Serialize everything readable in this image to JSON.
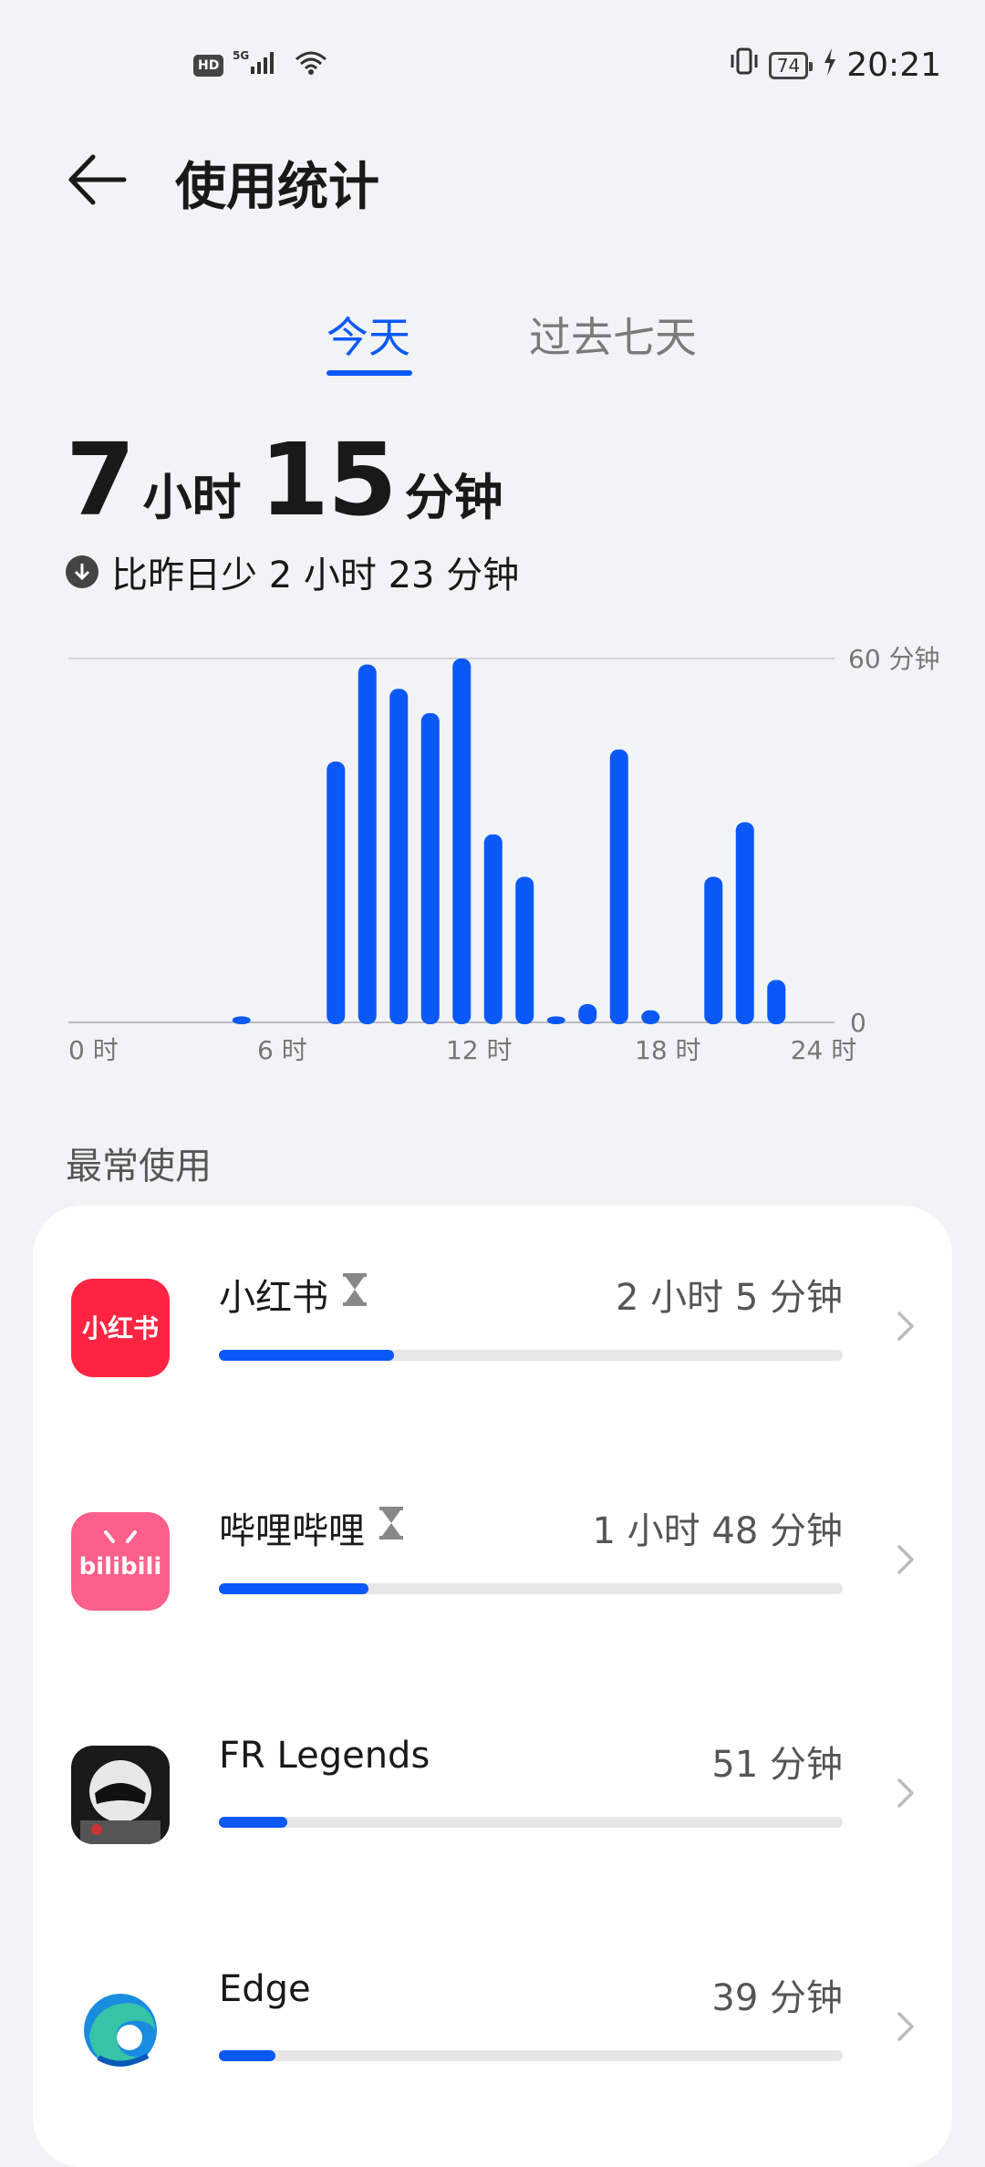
{
  "status_bar": {
    "left_badge": "HD",
    "network": "5G",
    "battery": "74",
    "time": "20:21"
  },
  "header": {
    "title": "使用统计",
    "back_icon": "back-arrow-icon"
  },
  "tabs": [
    {
      "label": "今天",
      "active": true
    },
    {
      "label": "过去七天",
      "active": false
    }
  ],
  "summary": {
    "hours": "7",
    "hours_unit": "小时",
    "minutes": "15",
    "minutes_unit": "分钟",
    "compare_text": "比昨日少 2 小时 23 分钟"
  },
  "chart_data": {
    "type": "bar",
    "title": "",
    "xlabel": "",
    "ylabel": "",
    "ylim": [
      0,
      60
    ],
    "y_tick_labels": [
      "60 分钟",
      "0"
    ],
    "x_tick_labels": [
      "0 时",
      "6 时",
      "12 时",
      "18 时",
      "24 时"
    ],
    "categories": [
      "0",
      "1",
      "2",
      "3",
      "4",
      "5",
      "6",
      "7",
      "8",
      "9",
      "10",
      "11",
      "12",
      "13",
      "14",
      "15",
      "16",
      "17",
      "18",
      "19",
      "20",
      "21",
      "22",
      "23"
    ],
    "values": [
      0,
      0,
      0,
      0,
      0,
      1,
      0,
      0,
      43,
      59,
      55,
      51,
      60,
      31,
      24,
      1,
      3,
      45,
      2,
      0,
      24,
      33,
      7,
      0
    ],
    "bar_color": "#0a59f7",
    "grid": true
  },
  "section_title": "最常使用",
  "apps": [
    {
      "name": "小红书",
      "time": "2 小时 5 分钟",
      "fraction": 0.28,
      "timer_icon": true,
      "icon": "xiaohongshu-app-icon",
      "icon_text": "小红书"
    },
    {
      "name": "哔哩哔哩",
      "time": "1 小时 48 分钟",
      "fraction": 0.24,
      "timer_icon": true,
      "icon": "bilibili-app-icon",
      "icon_text": "bilibili"
    },
    {
      "name": "FR Legends",
      "time": "51 分钟",
      "fraction": 0.11,
      "timer_icon": false,
      "icon": "fr-legends-app-icon"
    },
    {
      "name": "Edge",
      "time": "39 分钟",
      "fraction": 0.09,
      "timer_icon": false,
      "icon": "edge-app-icon"
    }
  ],
  "colors": {
    "accent": "#0a59f7",
    "background": "#f1f3f5",
    "card": "#ffffff"
  }
}
